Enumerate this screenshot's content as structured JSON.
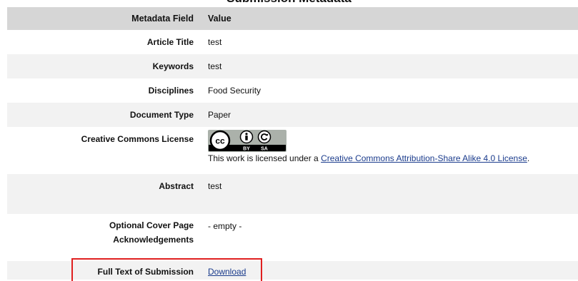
{
  "page_title": "Submission Metadata",
  "header": {
    "field_label": "Metadata Field",
    "value_label": "Value"
  },
  "rows": {
    "article_title": {
      "label": "Article Title",
      "value": "test"
    },
    "keywords": {
      "label": "Keywords",
      "value": "test"
    },
    "disciplines": {
      "label": "Disciplines",
      "value": "Food Security"
    },
    "document_type": {
      "label": "Document Type",
      "value": "Paper"
    },
    "license": {
      "label": "Creative Commons License",
      "text_prefix": "This work is licensed under a ",
      "link_text": "Creative Commons Attribution-Share Alike 4.0 License",
      "text_suffix": ".",
      "badge_by": "BY",
      "badge_sa": "SA"
    },
    "abstract": {
      "label": "Abstract",
      "value": "test"
    },
    "cover_page": {
      "label_line1": "Optional Cover Page",
      "label_line2": "Acknowledgements",
      "value": "- empty -"
    },
    "full_text": {
      "label": "Full Text of Submission",
      "link_text": "Download"
    }
  },
  "colors": {
    "header_bg": "#d6d6d6",
    "stripe_bg": "#f2f2f2",
    "link": "#1a3b8c",
    "highlight": "#e02020"
  }
}
